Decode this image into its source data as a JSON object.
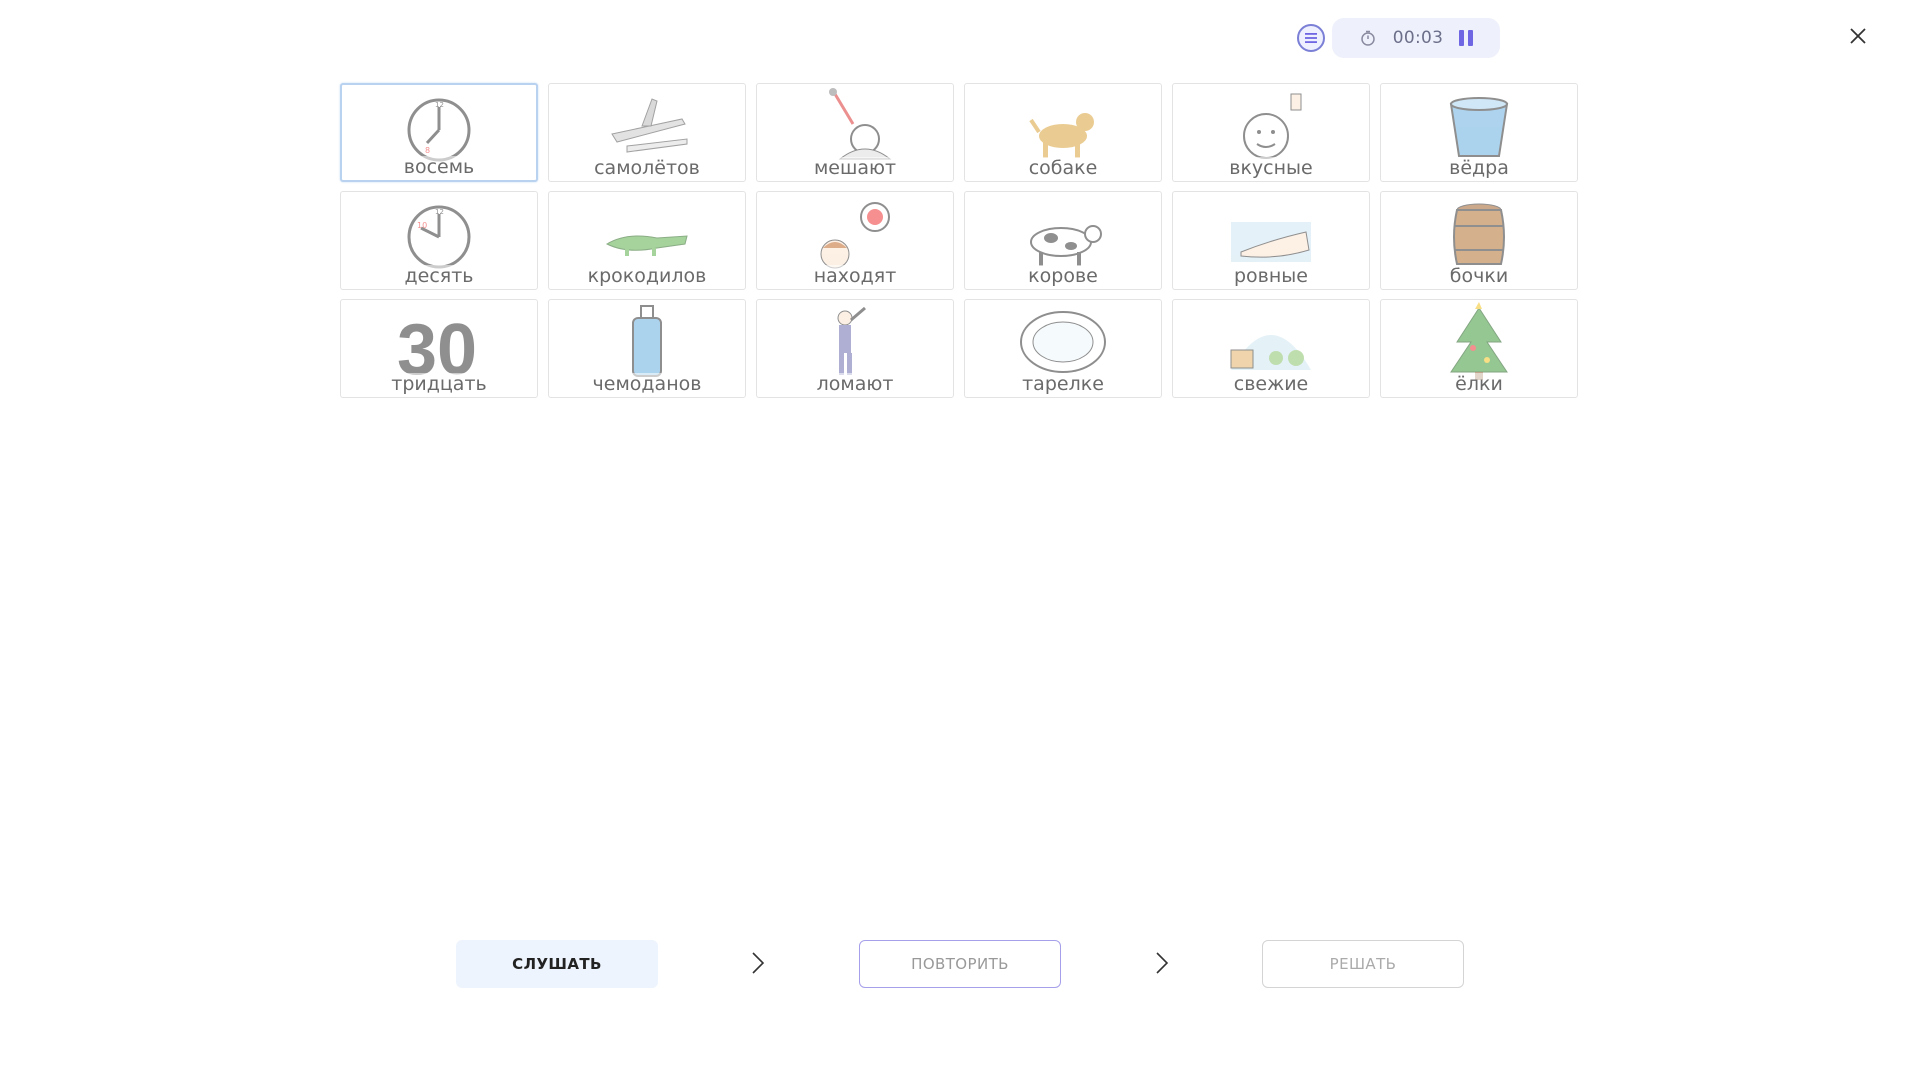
{
  "timer": {
    "value": "00:03"
  },
  "colors": {
    "accent": "#6e66e2",
    "selected_border": "#b9d2f0",
    "listen_bg": "#eef4fd"
  },
  "icons": {
    "menu": "list-icon",
    "timer": "stopwatch-icon",
    "pause": "pause-icon",
    "close": "close-icon",
    "next": "chevron-right-icon"
  },
  "cards": [
    {
      "word": "восемь",
      "icon": "clock-eight-icon",
      "selected": true
    },
    {
      "word": "самолётов",
      "icon": "airplanes-icon"
    },
    {
      "word": "мешают",
      "icon": "disturb-icon"
    },
    {
      "word": "собаке",
      "icon": "dog-icon"
    },
    {
      "word": "вкусные",
      "icon": "tasty-icon"
    },
    {
      "word": "вёдра",
      "icon": "bucket-icon"
    },
    {
      "word": "десять",
      "icon": "clock-ten-icon"
    },
    {
      "word": "крокодилов",
      "icon": "crocodile-icon"
    },
    {
      "word": "находят",
      "icon": "find-icon"
    },
    {
      "word": "корове",
      "icon": "cow-icon"
    },
    {
      "word": "ровные",
      "icon": "flat-surface-icon"
    },
    {
      "word": "бочки",
      "icon": "barrel-icon"
    },
    {
      "word": "тридцать",
      "icon": "number-thirty-icon"
    },
    {
      "word": "чемоданов",
      "icon": "suitcase-icon"
    },
    {
      "word": "ломают",
      "icon": "break-icon"
    },
    {
      "word": "тарелке",
      "icon": "plate-icon"
    },
    {
      "word": "свежие",
      "icon": "fresh-vegetables-icon"
    },
    {
      "word": "ёлки",
      "icon": "christmas-tree-icon"
    }
  ],
  "buttons": {
    "listen": "СЛУШАТЬ",
    "repeat": "ПОВТОРИТЬ",
    "solve": "РЕШАТЬ"
  }
}
